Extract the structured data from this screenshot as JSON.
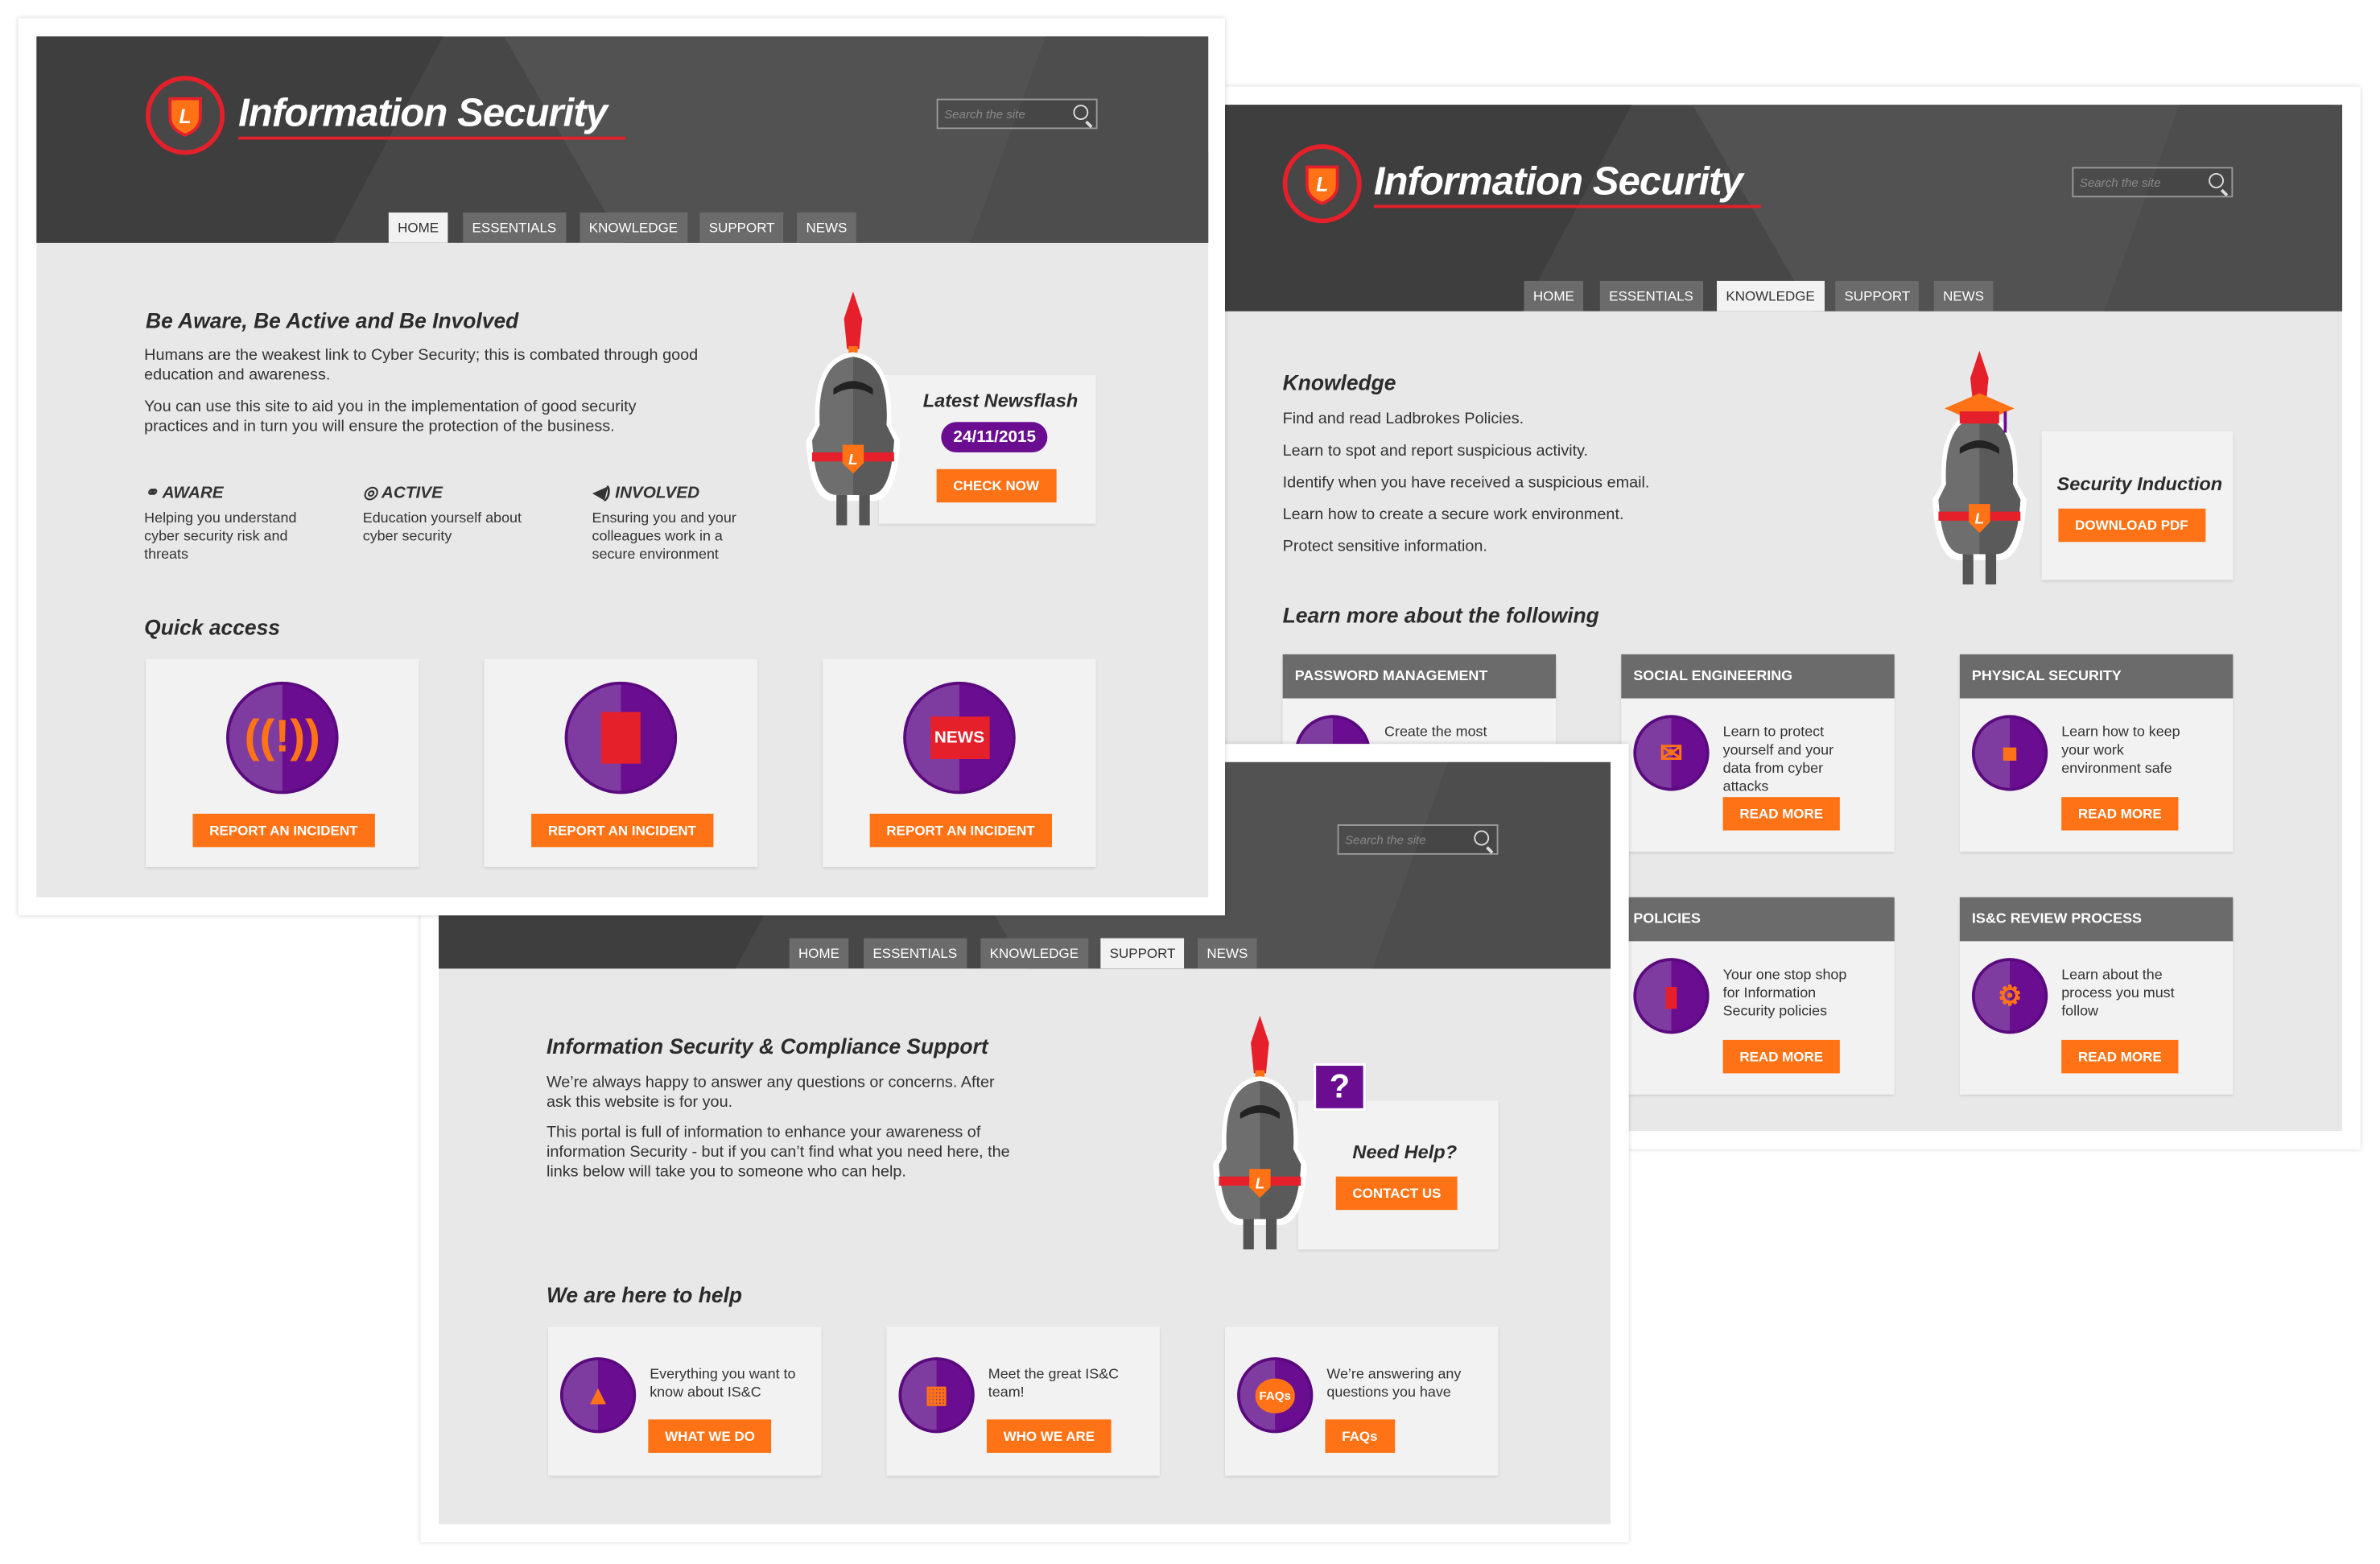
{
  "colors": {
    "accent_orange": "#ff7316",
    "brand_purple": "#6a0d91",
    "brand_red": "#e5202a",
    "header_dark": "#474747"
  },
  "brand": {
    "title": "Information Security",
    "logo_letter": "L"
  },
  "search": {
    "placeholder": "Search the site"
  },
  "nav": [
    "HOME",
    "ESSENTIALS",
    "KNOWLEDGE",
    "SUPPORT",
    "NEWS"
  ],
  "home": {
    "active_tab": "HOME",
    "heading": "Be Aware, Be Active and Be Involved",
    "paragraphs": [
      "Humans are the weakest link to Cyber Security; this is combated through good education and awareness.",
      "You can use this site to aid you in the implementation of good security practices and in turn you will ensure the protection of the business."
    ],
    "features": [
      {
        "icon": "binoculars-icon",
        "title": "AWARE",
        "text": "Helping you understand cyber security risk and threats"
      },
      {
        "icon": "target-icon",
        "title": "ACTIVE",
        "text": "Education yourself about cyber security"
      },
      {
        "icon": "megaphone-icon",
        "title": "INVOLVED",
        "text": "Ensuring you and your colleagues work in a secure environment"
      }
    ],
    "newsflash": {
      "title": "Latest Newsflash",
      "date": "24/11/2015",
      "button": "CHECK NOW"
    },
    "quick_access": {
      "heading": "Quick access",
      "cards": [
        {
          "icon": "alarm-icon",
          "button": "REPORT AN INCIDENT"
        },
        {
          "icon": "document-icon",
          "button": "REPORT AN INCIDENT"
        },
        {
          "icon": "news-icon",
          "icon_text": "NEWS",
          "button": "REPORT AN INCIDENT"
        }
      ]
    }
  },
  "knowledge": {
    "active_tab": "KNOWLEDGE",
    "heading": "Knowledge",
    "lines": [
      "Find and read Ladbrokes Policies.",
      "Learn to spot and report suspicious activity.",
      "Identify when you have received a suspicious email.",
      "Learn how to create a secure work environment.",
      "Protect sensitive information."
    ],
    "induction": {
      "title": "Security Induction",
      "button": "DOWNLOAD PDF"
    },
    "learn_heading": "Learn more about the following",
    "cards": [
      {
        "title": "PASSWORD MANAGEMENT",
        "text": "Create the most",
        "icon": "lock-icon"
      },
      {
        "title": "SOCIAL ENGINEERING",
        "text": "Learn to protect yourself and your data from cyber attacks",
        "button": "READ MORE",
        "icon": "envelope-alert-icon"
      },
      {
        "title": "PHYSICAL SECURITY",
        "text": "Learn how to keep your work environment safe",
        "button": "READ MORE",
        "icon": "briefcase-shield-icon"
      },
      {
        "title": "POLICIES",
        "text": "Your one stop shop for Information Security policies",
        "button": "READ MORE",
        "icon": "document-icon"
      },
      {
        "title": "IS&C REVIEW PROCESS",
        "text": "Learn about the process you must follow",
        "button": "READ MORE",
        "icon": "gear-lock-icon"
      }
    ]
  },
  "support": {
    "active_tab": "SUPPORT",
    "heading": "Information Security & Compliance Support",
    "paragraphs": [
      "We’re always happy to answer any questions or concerns. After ask this website is for you.",
      "This portal is full of information to enhance your awareness of information Security - but if you can’t find what you need here, the links below will take you to someone who can help."
    ],
    "help": {
      "title": "Need Help?",
      "button": "CONTACT US",
      "bubble": "?"
    },
    "here_heading": "We are here to help",
    "cards": [
      {
        "text": "Everything you want to know about IS&C",
        "button": "WHAT WE DO",
        "icon": "knight-helmet-icon"
      },
      {
        "text": "Meet the great IS&C team!",
        "button": "WHO WE ARE",
        "icon": "org-chart-icon"
      },
      {
        "text": "We’re answering any questions you have",
        "button": "FAQs",
        "icon": "faq-bubble-icon",
        "icon_text": "FAQs"
      }
    ]
  }
}
